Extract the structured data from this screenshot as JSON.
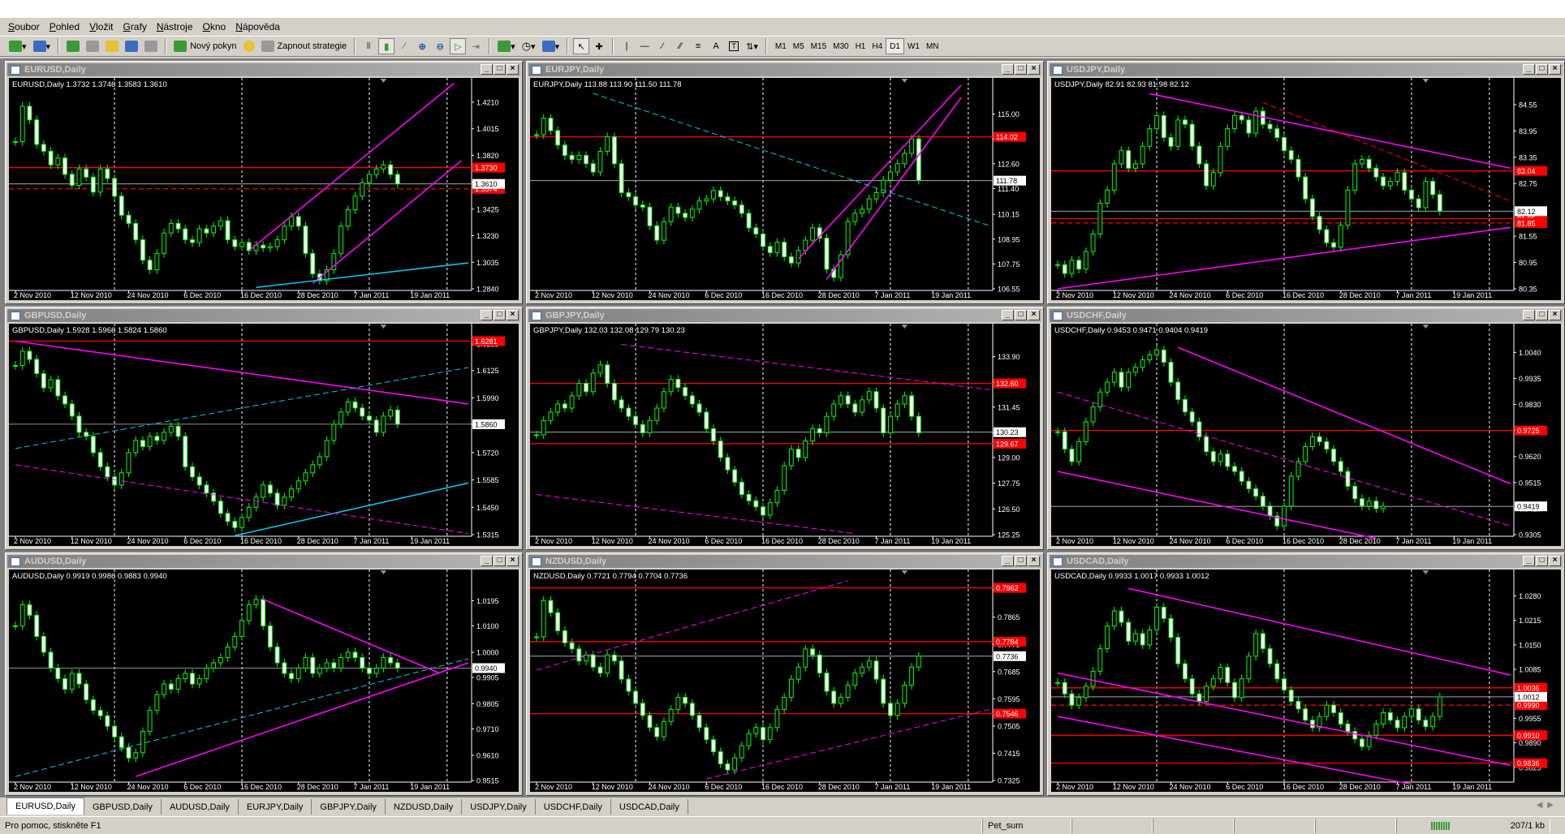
{
  "menu": [
    "Soubor",
    "Pohled",
    "Vložit",
    "Grafy",
    "Nástroje",
    "Okno",
    "Nápověda"
  ],
  "toolbar": {
    "new_order_label": "Nový pokyn",
    "strategies_label": "Zapnout strategie",
    "line_tool_label": "A",
    "text_tool_label": "T",
    "timeframes": [
      "M1",
      "M5",
      "M15",
      "M30",
      "H1",
      "H4",
      "D1",
      "W1",
      "MN"
    ],
    "active_timeframe": "D1"
  },
  "x_dates": [
    "2 Nov 2010",
    "12 Nov 2010",
    "24 Nov 2010",
    "6 Dec 2010",
    "16 Dec 2010",
    "28 Dec 2010",
    "7 Jan 2011",
    "19 Jan 2011"
  ],
  "colors": {
    "candle": "#00ff00",
    "chart_bg": "#000000",
    "resistance": "#ff0000",
    "trend_magenta": "#ff00ff",
    "trend_cyan": "#00c8e6",
    "last_price": "#c0c0c0"
  },
  "charts": [
    {
      "title": "EURUSD,Daily",
      "ohlc": "EURUSD,Daily  1.3732 1.3746 1.3583 1.3610",
      "y_min": 1.284,
      "y_max": 1.4305,
      "ticks": [
        "1.4210",
        "1.4015",
        "1.3820",
        "1.3625",
        "1.3425",
        "1.3230",
        "1.3035",
        "1.2840"
      ],
      "tick_values": [
        1.421,
        1.4015,
        1.382,
        1.3625,
        1.3425,
        1.323,
        1.3035,
        1.284
      ],
      "last": 1.361,
      "last_label": "1.3610",
      "hlines": [
        {
          "v": 1.373,
          "label": "1.3730",
          "style": "solid"
        },
        {
          "v": 1.3574,
          "label": "1.3574",
          "style": "dash"
        }
      ],
      "closes": [
        1.392,
        1.418,
        1.408,
        1.39,
        1.385,
        1.375,
        1.38,
        1.368,
        1.36,
        1.372,
        1.366,
        1.355,
        1.372,
        1.365,
        1.352,
        1.338,
        1.332,
        1.32,
        1.305,
        1.298,
        1.31,
        1.325,
        1.332,
        1.328,
        1.32,
        1.318,
        1.328,
        1.325,
        1.33,
        1.334,
        1.32,
        1.315,
        1.318,
        1.312,
        1.316,
        1.314,
        1.315,
        1.32,
        1.33,
        1.337,
        1.33,
        1.31,
        1.295,
        1.29,
        1.298,
        1.31,
        1.33,
        1.342,
        1.352,
        1.362,
        1.368,
        1.372,
        1.375,
        1.368,
        1.361
      ],
      "trend_lines": [
        {
          "color": "magenta",
          "style": "solid",
          "i1": 33,
          "v1": 1.312,
          "i2": 62,
          "v2": 1.435
        },
        {
          "color": "magenta",
          "style": "solid",
          "i1": 42,
          "v1": 1.288,
          "i2": 63,
          "v2": 1.378
        },
        {
          "color": "cyan",
          "style": "solid",
          "i1": 34,
          "v1": 1.285,
          "i2": 64,
          "v2": 1.303
        }
      ]
    },
    {
      "title": "EURJPY,Daily",
      "ohlc": "EURJPY,Daily  113.88 113.90 111.50 111.78",
      "y_min": 106.55,
      "y_max": 116.2,
      "ticks": [
        "115.00",
        "113.80",
        "112.60",
        "111.40",
        "110.15",
        "108.95",
        "107.75",
        "106.55"
      ],
      "tick_values": [
        115.0,
        113.8,
        112.6,
        111.4,
        110.15,
        108.95,
        107.75,
        106.55
      ],
      "last": 111.78,
      "last_label": "111.78",
      "hlines": [
        {
          "v": 113.9,
          "label": "114.02",
          "style": "solid"
        }
      ],
      "closes": [
        114.0,
        114.8,
        114.2,
        113.5,
        113.0,
        112.8,
        113.0,
        112.6,
        112.2,
        113.2,
        113.9,
        112.6,
        111.2,
        111.0,
        110.6,
        110.5,
        109.6,
        108.9,
        109.8,
        110.5,
        110.2,
        110.0,
        110.4,
        110.8,
        110.9,
        111.3,
        111.0,
        110.8,
        110.6,
        110.2,
        109.5,
        109.2,
        108.6,
        108.3,
        108.8,
        108.1,
        107.8,
        108.4,
        108.9,
        109.5,
        109.0,
        107.5,
        107.1,
        108.2,
        109.8,
        110.2,
        110.4,
        110.9,
        111.2,
        111.8,
        112.2,
        112.6,
        113.1,
        113.8,
        111.8
      ],
      "trend_lines": [
        {
          "color": "magenta",
          "style": "solid",
          "i1": 37,
          "v1": 108.0,
          "i2": 60,
          "v2": 116.4
        },
        {
          "color": "magenta",
          "style": "solid",
          "i1": 41,
          "v1": 107.0,
          "i2": 60,
          "v2": 115.8
        },
        {
          "color": "cyan",
          "style": "dash",
          "i1": 8,
          "v1": 116.0,
          "i2": 64,
          "v2": 109.6
        }
      ]
    },
    {
      "title": "USDJPY,Daily",
      "ohlc": "USDJPY,Daily  82.91 82.93 81.98 82.12",
      "y_min": 80.35,
      "y_max": 84.9,
      "ticks": [
        "84.55",
        "83.95",
        "83.35",
        "82.75",
        "82.15",
        "81.55",
        "80.95",
        "80.35"
      ],
      "tick_values": [
        84.55,
        83.95,
        83.35,
        82.75,
        82.15,
        81.55,
        80.95,
        80.35
      ],
      "last": 82.12,
      "last_label": "82.12",
      "hlines": [
        {
          "v": 83.04,
          "label": "83.04",
          "style": "solid"
        },
        {
          "v": 81.95,
          "label": "81.95",
          "style": "solid"
        },
        {
          "v": 81.85,
          "label": "81.85",
          "style": "dash"
        }
      ],
      "closes": [
        80.9,
        80.7,
        81.0,
        80.8,
        81.2,
        81.6,
        82.3,
        82.6,
        83.2,
        83.5,
        83.1,
        83.2,
        83.6,
        84.0,
        84.3,
        83.8,
        83.6,
        84.2,
        84.1,
        83.6,
        83.2,
        82.7,
        83.0,
        83.6,
        84.0,
        84.3,
        84.2,
        83.9,
        84.4,
        84.1,
        84.0,
        83.8,
        83.5,
        83.3,
        82.9,
        82.4,
        82.0,
        81.7,
        81.4,
        81.3,
        81.8,
        82.6,
        83.2,
        83.3,
        83.1,
        82.9,
        82.7,
        82.8,
        83.0,
        82.6,
        82.4,
        82.2,
        82.8,
        82.5,
        82.12
      ],
      "trend_lines": [
        {
          "color": "magenta",
          "style": "solid",
          "i1": 0,
          "v1": 80.35,
          "i2": 64,
          "v2": 81.75
        },
        {
          "color": "magenta",
          "style": "solid",
          "i1": 13,
          "v1": 84.8,
          "i2": 64,
          "v2": 83.1
        },
        {
          "color": "red",
          "style": "dash",
          "i1": 29,
          "v1": 84.6,
          "i2": 64,
          "v2": 82.35
        }
      ]
    },
    {
      "title": "GBPUSD,Daily",
      "ohlc": "GBPUSD,Daily  1.5928 1.5966 1.5824 1.5860",
      "y_min": 1.5315,
      "y_max": 1.63,
      "ticks": [
        "1.6255",
        "1.6125",
        "1.5990",
        "1.5860",
        "1.5720",
        "1.5585",
        "1.5450",
        "1.5315"
      ],
      "tick_values": [
        1.6255,
        1.6125,
        1.599,
        1.586,
        1.572,
        1.5585,
        1.545,
        1.5315
      ],
      "last": 1.586,
      "last_label": "1.5860",
      "hlines": [
        {
          "v": 1.627,
          "label": "1.6281",
          "style": "solid"
        }
      ],
      "closes": [
        1.615,
        1.622,
        1.618,
        1.611,
        1.604,
        1.608,
        1.6,
        1.596,
        1.59,
        1.582,
        1.58,
        1.572,
        1.565,
        1.56,
        1.556,
        1.562,
        1.572,
        1.578,
        1.575,
        1.58,
        1.578,
        1.582,
        1.585,
        1.58,
        1.565,
        1.56,
        1.556,
        1.552,
        1.548,
        1.542,
        1.538,
        1.535,
        1.54,
        1.545,
        1.55,
        1.556,
        1.552,
        1.546,
        1.55,
        1.554,
        1.558,
        1.562,
        1.566,
        1.57,
        1.578,
        1.586,
        1.592,
        1.597,
        1.594,
        1.59,
        1.588,
        1.582,
        1.59,
        1.593,
        1.586
      ],
      "trend_lines": [
        {
          "color": "magenta",
          "style": "solid",
          "i1": 0,
          "v1": 1.627,
          "i2": 64,
          "v2": 1.596
        },
        {
          "color": "cyan",
          "style": "solid",
          "i1": 31,
          "v1": 1.531,
          "i2": 64,
          "v2": 1.557
        },
        {
          "color": "cyan",
          "style": "dash",
          "i1": 0,
          "v1": 1.574,
          "i2": 64,
          "v2": 1.614
        },
        {
          "color": "magenta",
          "style": "dash",
          "i1": 0,
          "v1": 1.566,
          "i2": 64,
          "v2": 1.532
        }
      ]
    },
    {
      "title": "GBPJPY,Daily",
      "ohlc": "GBPJPY,Daily  132.03 132.08 129.79 130.23",
      "y_min": 125.25,
      "y_max": 134.95,
      "ticks": [
        "133.90",
        "132.65",
        "131.45",
        "130.20",
        "129.00",
        "127.75",
        "126.50",
        "125.25"
      ],
      "tick_values": [
        133.9,
        132.65,
        131.45,
        130.2,
        129.0,
        127.75,
        126.5,
        125.25
      ],
      "last": 130.23,
      "last_label": "130.23",
      "hlines": [
        {
          "v": 132.6,
          "label": "132.60",
          "style": "solid"
        },
        {
          "v": 129.67,
          "label": "129.67",
          "style": "solid"
        }
      ],
      "closes": [
        130.1,
        130.8,
        131.2,
        131.6,
        131.4,
        132.0,
        132.6,
        132.2,
        133.1,
        133.5,
        132.6,
        131.8,
        131.4,
        131.0,
        130.6,
        130.2,
        130.8,
        131.4,
        132.2,
        132.8,
        132.4,
        132.0,
        131.6,
        131.2,
        130.4,
        129.8,
        129.0,
        128.4,
        127.8,
        127.2,
        126.9,
        126.6,
        126.2,
        126.8,
        127.4,
        128.6,
        129.4,
        129.0,
        129.8,
        130.4,
        130.2,
        131.0,
        131.6,
        132.0,
        131.6,
        131.2,
        131.8,
        132.2,
        131.4,
        130.2,
        131.0,
        131.6,
        132.0,
        131.0,
        130.2
      ],
      "trend_lines": [
        {
          "color": "magenta",
          "style": "dash",
          "i1": 12,
          "v1": 134.5,
          "i2": 64,
          "v2": 132.3
        },
        {
          "color": "magenta",
          "style": "dash",
          "i1": 0,
          "v1": 127.2,
          "i2": 45,
          "v2": 125.3
        }
      ]
    },
    {
      "title": "USDCHF,Daily",
      "ohlc": "USDCHF,Daily  0.9453 0.9471 0.9404 0.9419",
      "y_min": 0.9305,
      "y_max": 1.011,
      "ticks": [
        "1.0040",
        "0.9935",
        "0.9830",
        "0.9725",
        "0.9620",
        "0.9515",
        "0.9410",
        "0.9305"
      ],
      "tick_values": [
        1.004,
        0.9935,
        0.983,
        0.9725,
        0.962,
        0.9515,
        0.941,
        0.9305
      ],
      "last": 0.9419,
      "last_label": "0.9419",
      "hlines": [
        {
          "v": 0.9725,
          "label": "0.9725",
          "style": "solid"
        }
      ],
      "closes": [
        0.972,
        0.965,
        0.96,
        0.968,
        0.976,
        0.982,
        0.988,
        0.992,
        0.996,
        0.99,
        0.996,
        0.998,
        1.001,
        1.003,
        1.005,
        1.0,
        0.992,
        0.985,
        0.98,
        0.976,
        0.97,
        0.964,
        0.96,
        0.963,
        0.958,
        0.956,
        0.952,
        0.949,
        0.946,
        0.942,
        0.938,
        0.934,
        0.942,
        0.954,
        0.96,
        0.966,
        0.97,
        0.968,
        0.965,
        0.96,
        0.956,
        0.95,
        0.945,
        0.942,
        0.944,
        0.941,
        0.942
      ],
      "trend_lines": [
        {
          "color": "magenta",
          "style": "solid",
          "i1": 17,
          "v1": 1.006,
          "i2": 64,
          "v2": 0.951
        },
        {
          "color": "magenta",
          "style": "solid",
          "i1": 0,
          "v1": 0.956,
          "i2": 45,
          "v2": 0.929
        },
        {
          "color": "magenta",
          "style": "dash",
          "i1": 0,
          "v1": 0.988,
          "i2": 64,
          "v2": 0.934
        }
      ]
    },
    {
      "title": "AUDUSD,Daily",
      "ohlc": "AUDUSD,Daily  0.9919 0.9986 0.9883 0.9940",
      "y_min": 0.9515,
      "y_max": 1.027,
      "ticks": [
        "1.0195",
        "1.0100",
        "1.0000",
        "0.9905",
        "0.9805",
        "0.9710",
        "0.9610",
        "0.9515"
      ],
      "tick_values": [
        1.0195,
        1.01,
        1.0,
        0.9905,
        0.9805,
        0.971,
        0.961,
        0.9515
      ],
      "last": 0.994,
      "last_label": "0.9940",
      "hlines": [],
      "closes": [
        1.01,
        1.018,
        1.014,
        1.006,
        1.0,
        0.994,
        0.99,
        0.986,
        0.992,
        0.988,
        0.982,
        0.978,
        0.976,
        0.972,
        0.968,
        0.964,
        0.96,
        0.962,
        0.97,
        0.978,
        0.984,
        0.988,
        0.986,
        0.99,
        0.992,
        0.988,
        0.99,
        0.994,
        0.996,
        0.998,
        1.002,
        1.006,
        1.012,
        1.018,
        1.02,
        1.01,
        1.002,
        0.996,
        0.992,
        0.99,
        0.994,
        0.998,
        0.992,
        0.994,
        0.996,
        0.994,
        0.998,
        1.0,
        0.998,
        0.994,
        0.992,
        0.994,
        0.998,
        0.996,
        0.994
      ],
      "trend_lines": [
        {
          "color": "magenta",
          "style": "solid",
          "i1": 17,
          "v1": 0.953,
          "i2": 64,
          "v2": 0.996
        },
        {
          "color": "magenta",
          "style": "solid",
          "i1": 35,
          "v1": 1.02,
          "i2": 60,
          "v2": 0.992
        },
        {
          "color": "cyan",
          "style": "dash",
          "i1": 0,
          "v1": 0.953,
          "i2": 64,
          "v2": 0.9975
        }
      ]
    },
    {
      "title": "NZDUSD,Daily",
      "ohlc": "NZDUSD,Daily  0.7721 0.7794 0.7704 0.7736",
      "y_min": 0.7325,
      "y_max": 0.7985,
      "ticks": [
        "0.7955",
        "0.7865",
        "0.7775",
        "0.7685",
        "0.7595",
        "0.7505",
        "0.7415",
        "0.7325"
      ],
      "tick_values": [
        0.7955,
        0.7865,
        0.7775,
        0.7685,
        0.7595,
        0.7505,
        0.7415,
        0.7325
      ],
      "last": 0.7736,
      "last_label": "0.7736",
      "hlines": [
        {
          "v": 0.7962,
          "label": "0.7962",
          "style": "solid"
        },
        {
          "v": 0.7784,
          "label": "0.7784",
          "style": "solid"
        },
        {
          "v": 0.7546,
          "label": "0.7546",
          "style": "solid"
        }
      ],
      "closes": [
        0.78,
        0.792,
        0.788,
        0.782,
        0.778,
        0.776,
        0.772,
        0.774,
        0.77,
        0.768,
        0.774,
        0.772,
        0.766,
        0.762,
        0.758,
        0.754,
        0.75,
        0.747,
        0.752,
        0.756,
        0.76,
        0.758,
        0.754,
        0.75,
        0.746,
        0.742,
        0.738,
        0.736,
        0.74,
        0.744,
        0.748,
        0.75,
        0.746,
        0.75,
        0.756,
        0.76,
        0.766,
        0.77,
        0.776,
        0.774,
        0.768,
        0.762,
        0.758,
        0.76,
        0.764,
        0.768,
        0.77,
        0.772,
        0.766,
        0.758,
        0.754,
        0.758,
        0.764,
        0.77,
        0.7736
      ],
      "trend_lines": [
        {
          "color": "magenta",
          "style": "dash",
          "i1": 0,
          "v1": 0.769,
          "i2": 44,
          "v2": 0.7985
        },
        {
          "color": "magenta",
          "style": "dash",
          "i1": 24,
          "v1": 0.733,
          "i2": 64,
          "v2": 0.756
        }
      ]
    },
    {
      "title": "USDCAD,Daily",
      "ohlc": "USDCAD,Daily  0.9933 1.0017 0.9933 1.0012",
      "y_min": 0.979,
      "y_max": 1.032,
      "ticks": [
        "1.0280",
        "1.0215",
        "1.0150",
        "1.0085",
        "1.0020",
        "0.9955",
        "0.9890",
        "0.9825"
      ],
      "tick_values": [
        1.028,
        1.0215,
        1.015,
        1.0085,
        1.002,
        0.9955,
        0.989,
        0.9825
      ],
      "last": 1.0012,
      "last_label": "1.0012",
      "hlines": [
        {
          "v": 1.0036,
          "label": "1.0036",
          "style": "solid"
        },
        {
          "v": 0.999,
          "label": "0.9990",
          "style": "dash"
        },
        {
          "v": 0.991,
          "label": "0.9910",
          "style": "solid"
        },
        {
          "v": 0.9836,
          "label": "0.9836",
          "style": "solid"
        }
      ],
      "closes": [
        1.005,
        1.002,
        0.999,
        1.001,
        1.004,
        1.008,
        1.014,
        1.02,
        1.024,
        1.021,
        1.016,
        1.018,
        1.015,
        1.019,
        1.025,
        1.022,
        1.017,
        1.01,
        1.006,
        1.002,
        1.0,
        1.004,
        1.006,
        1.009,
        1.005,
        1.001,
        1.006,
        1.012,
        1.018,
        1.014,
        1.01,
        1.006,
        1.003,
        1.0,
        0.998,
        0.995,
        0.993,
        0.996,
        0.999,
        0.997,
        0.994,
        0.992,
        0.99,
        0.988,
        0.991,
        0.994,
        0.997,
        0.995,
        0.993,
        0.996,
        0.998,
        0.995,
        0.9933,
        0.996,
        1.0012
      ],
      "trend_lines": [
        {
          "color": "magenta",
          "style": "solid",
          "i1": 10,
          "v1": 1.03,
          "i2": 64,
          "v2": 1.007
        },
        {
          "color": "magenta",
          "style": "solid",
          "i1": 0,
          "v1": 0.996,
          "i2": 50,
          "v2": 0.978
        },
        {
          "color": "magenta",
          "style": "solid",
          "i1": 0,
          "v1": 1.0075,
          "i2": 64,
          "v2": 0.983
        }
      ]
    }
  ],
  "tabs": [
    "EURUSD,Daily",
    "GBPUSD,Daily",
    "AUDUSD,Daily",
    "EURJPY,Daily",
    "GBPJPY,Daily",
    "NZDUSD,Daily",
    "USDJPY,Daily",
    "USDCHF,Daily",
    "USDCAD,Daily"
  ],
  "active_tab": 0,
  "status": {
    "help": "Pro pomoc, stiskněte F1",
    "profile": "Pet_sum",
    "traffic": "207/1 kb"
  }
}
